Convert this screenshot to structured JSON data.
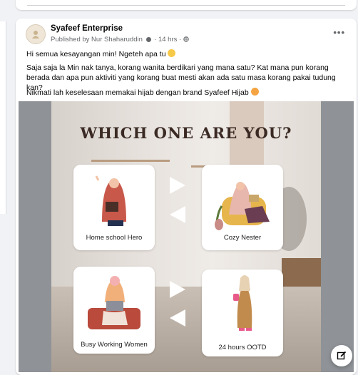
{
  "post": {
    "page_name": "Syafeef Enterprise",
    "published_prefix": "Published by ",
    "author": "Nur Shaharuddin",
    "time": "14 hrs",
    "text_1": "Hi semua kesayangan min! Ngeteh apa tu",
    "text_2": "Saja saja la Min nak tanya, korang wanita berdikari yang mana satu? Kat mana pun korang berada dan apa pun aktiviti yang korang buat mesti akan ada satu masa korang pakai tudung kan?",
    "text_3": "Nikmati lah keselesaan memakai hijab dengan brand Syafeef Hijab"
  },
  "image": {
    "title": "WHICH ONE ARE YOU?",
    "options": [
      "Home school Hero",
      "Cozy Nester",
      "Busy Working Women",
      "24 hours OOTD"
    ]
  },
  "icons": [
    "page-avatar-icon",
    "globe-icon",
    "more-options-icon",
    "edit-compose-icon"
  ],
  "colors": {
    "accent": "#65676b",
    "poster_title": "#3b2a24",
    "hijab_red": "#c8584a"
  }
}
